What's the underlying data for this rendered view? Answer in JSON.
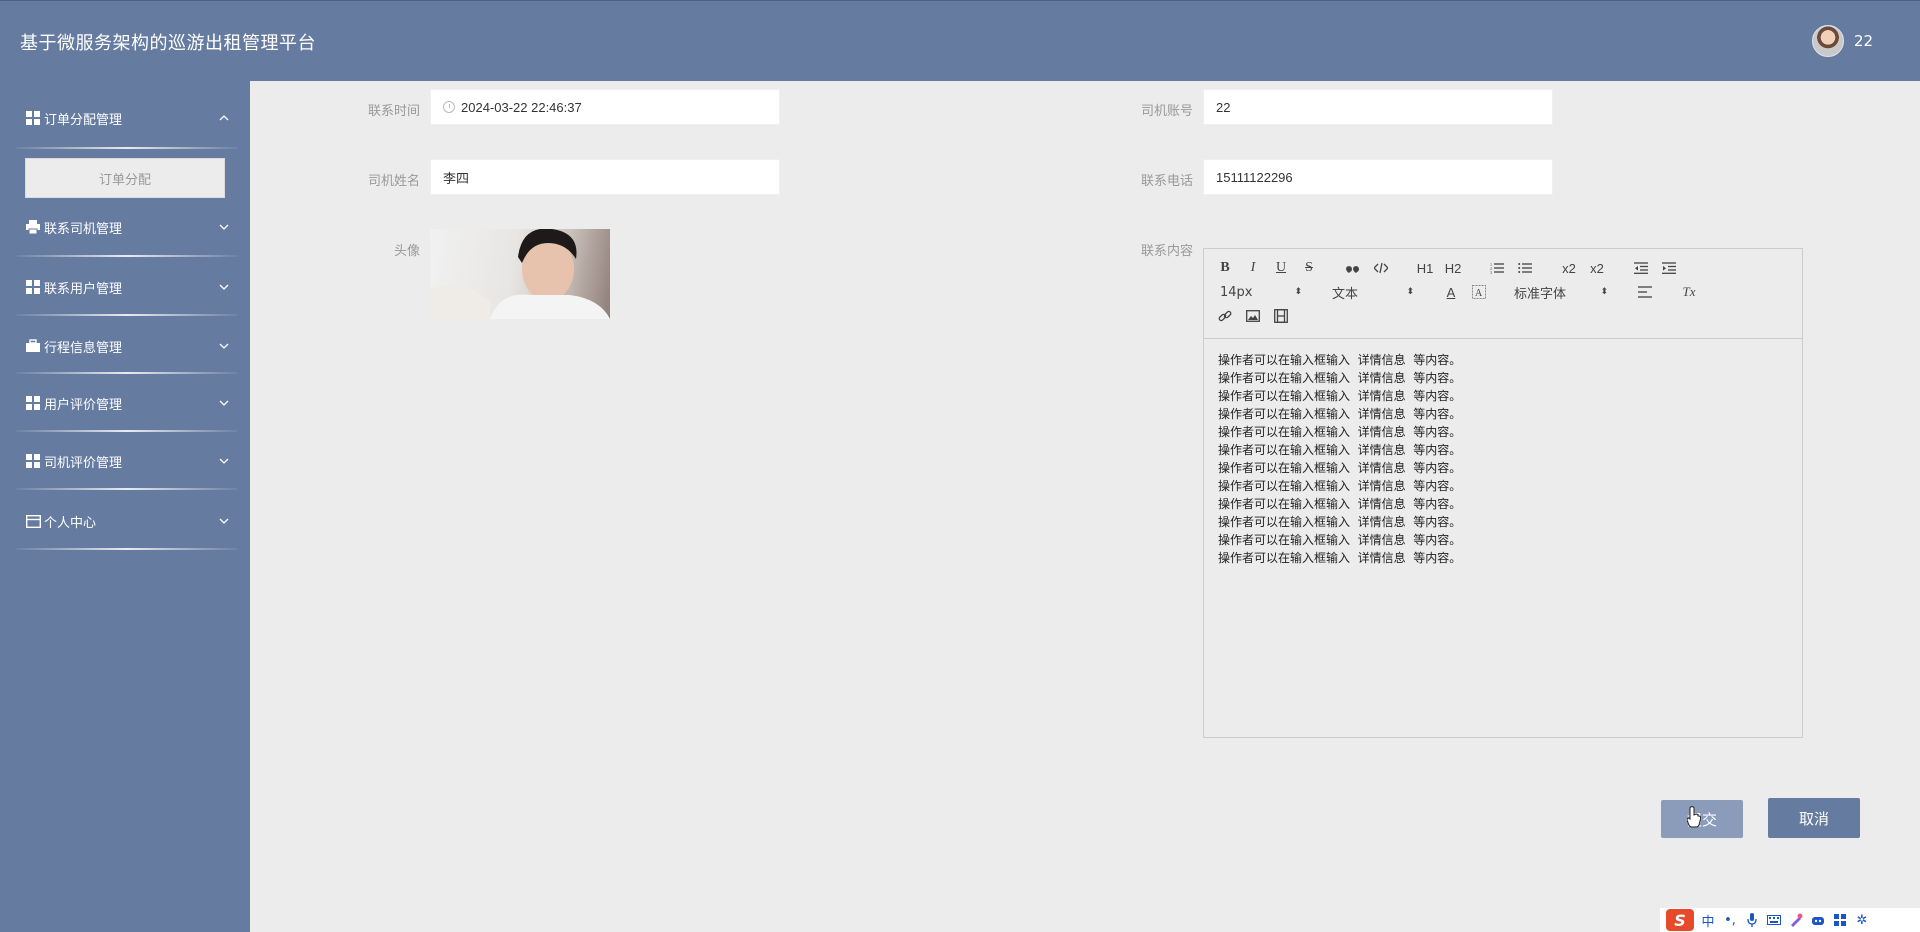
{
  "header": {
    "title": "基于微服务架构的巡游出租管理平台",
    "username": "22"
  },
  "sidebar": {
    "items": [
      {
        "label": "订单分配管理",
        "icon": "grid-icon",
        "expanded": true,
        "sub": [
          {
            "label": "订单分配"
          }
        ]
      },
      {
        "label": "联系司机管理",
        "icon": "printer-icon"
      },
      {
        "label": "联系用户管理",
        "icon": "grid-icon"
      },
      {
        "label": "行程信息管理",
        "icon": "briefcase-icon"
      },
      {
        "label": "用户评价管理",
        "icon": "grid-icon"
      },
      {
        "label": "司机评价管理",
        "icon": "grid-icon"
      },
      {
        "label": "个人中心",
        "icon": "card-icon"
      }
    ]
  },
  "form": {
    "contact_time": {
      "label": "联系时间",
      "value": "2024-03-22 22:46:37"
    },
    "driver_account": {
      "label": "司机账号",
      "value": "22"
    },
    "driver_name": {
      "label": "司机姓名",
      "value": "李四"
    },
    "phone": {
      "label": "联系电话",
      "value": "15111122296"
    },
    "avatar": {
      "label": "头像"
    },
    "content": {
      "label": "联系内容",
      "font_size": "14px",
      "text_type": "文本",
      "font_family": "标准字体",
      "lines": [
        "操作者可以在输入框输入  详情信息  等内容。",
        "操作者可以在输入框输入  详情信息  等内容。",
        "操作者可以在输入框输入  详情信息  等内容。",
        "操作者可以在输入框输入  详情信息  等内容。",
        "操作者可以在输入框输入  详情信息  等内容。",
        "操作者可以在输入框输入  详情信息  等内容。",
        "操作者可以在输入框输入  详情信息  等内容。",
        "操作者可以在输入框输入  详情信息  等内容。",
        "操作者可以在输入框输入  详情信息  等内容。",
        "操作者可以在输入框输入  详情信息  等内容。",
        "操作者可以在输入框输入  详情信息  等内容。",
        "操作者可以在输入框输入  详情信息  等内容。"
      ]
    }
  },
  "buttons": {
    "submit": "提交",
    "cancel": "取消"
  },
  "toolbar_labels": {
    "bold": "B",
    "italic": "I",
    "underline": "U",
    "strike": "S",
    "h1": "H1",
    "h2": "H2",
    "sub": "x2",
    "sup": "x2",
    "text_color": "A",
    "clear_format": "Tx"
  },
  "ime": {
    "lang": "中"
  },
  "colors": {
    "primary": "#657ba0",
    "submit": "#8a9cba",
    "background": "#ececec"
  }
}
